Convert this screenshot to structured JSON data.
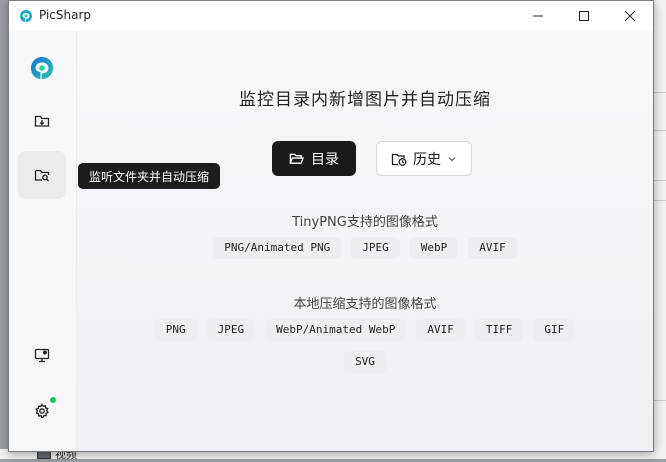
{
  "window": {
    "title": "PicSharp"
  },
  "sidebar": {
    "tooltip": "监听文件夹并自动压缩"
  },
  "main": {
    "headline": "监控目录内新增图片并自动压缩",
    "dir_button": "目录",
    "history_button": "历史",
    "tinypng_title": "TinyPNG支持的图像格式",
    "tinypng_formats": [
      "PNG/Animated PNG",
      "JPEG",
      "WebP",
      "AVIF"
    ],
    "local_title": "本地压缩支持的图像格式",
    "local_formats": [
      "PNG",
      "JPEG",
      "WebP/Animated WebP",
      "AVIF",
      "TIFF",
      "GIF",
      "SVG"
    ]
  },
  "taskbar": {
    "item": "视频"
  },
  "colors": {
    "accent_dark": "#1a1a1a",
    "notify": "#22c55e"
  }
}
